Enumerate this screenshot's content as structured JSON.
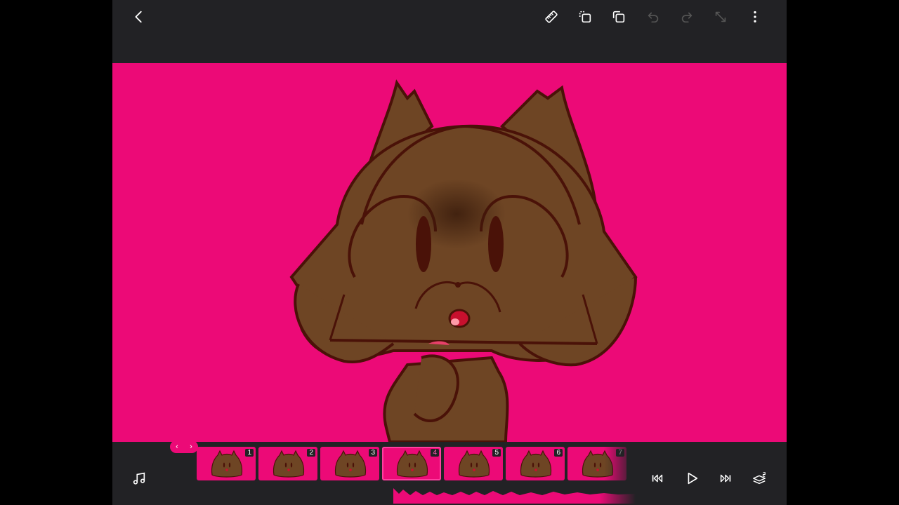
{
  "topbar": {
    "icons": [
      "back-icon",
      "ruler-icon",
      "duplicate-icon",
      "copy-icon",
      "undo-icon",
      "redo-icon",
      "resize-icon",
      "more-icon"
    ]
  },
  "timeline": {
    "frames": [
      {
        "label": "1"
      },
      {
        "label": "2"
      },
      {
        "label": "3"
      },
      {
        "label": "4"
      },
      {
        "label": "5"
      },
      {
        "label": "6"
      },
      {
        "label": "7"
      }
    ],
    "selected_frame": "4",
    "nav_prev": "‹",
    "nav_next": "›"
  },
  "colors": {
    "canvas_bg": "#ec0a77",
    "toolbar_bg": "#222225",
    "character_fill": "#6e4524",
    "outline": "#4a1208",
    "accent": "#ff3ea0"
  }
}
